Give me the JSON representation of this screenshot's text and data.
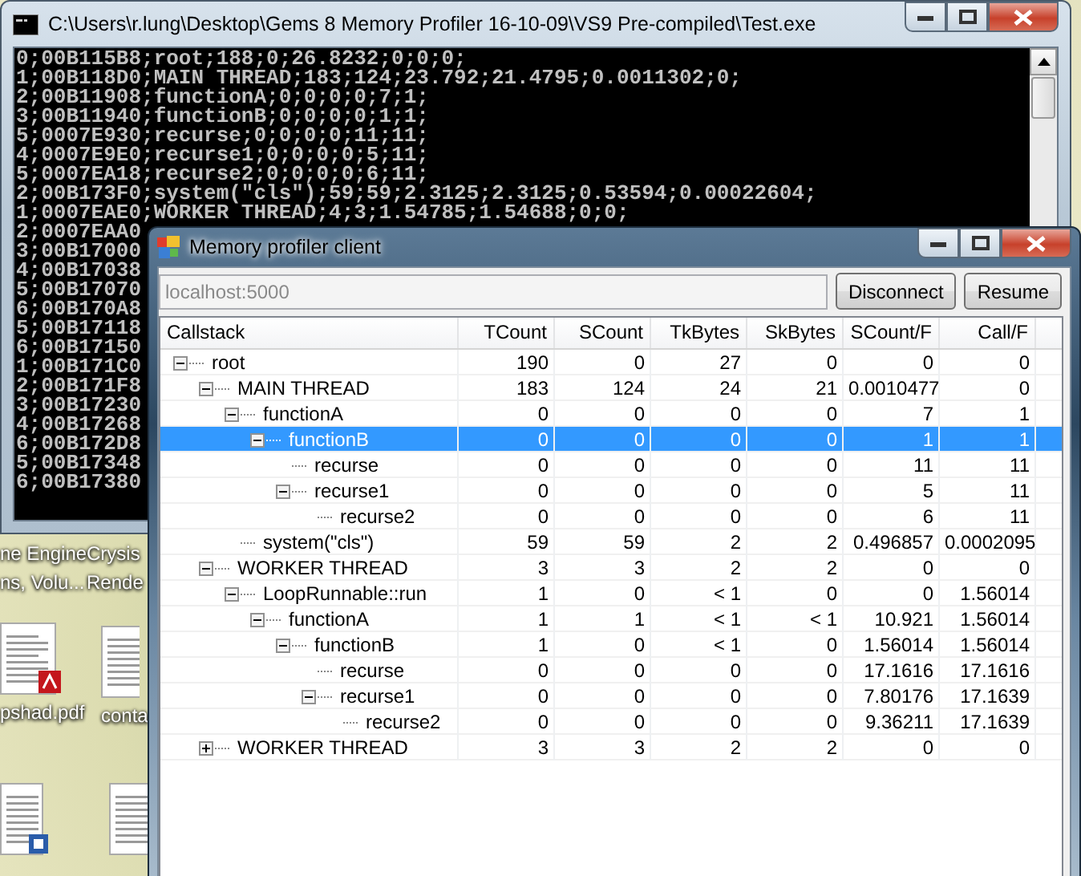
{
  "console": {
    "title": "C:\\Users\\r.lung\\Desktop\\Gems 8 Memory Profiler 16-10-09\\VS9 Pre-compiled\\Test.exe",
    "lines": [
      "0;00B115B8;root;188;0;26.8232;0;0;0;",
      "1;00B118D0;MAIN THREAD;183;124;23.792;21.4795;0.0011302;0;",
      "2;00B11908;functionA;0;0;0;0;7;1;",
      "3;00B11940;functionB;0;0;0;0;1;1;",
      "5;0007E930;recurse;0;0;0;0;11;11;",
      "4;0007E9E0;recurse1;0;0;0;0;5;11;",
      "5;0007EA18;recurse2;0;0;0;0;6;11;",
      "2;00B173F0;system(\"cls\");59;59;2.3125;2.3125;0.53594;0.00022604;",
      "1;0007EAE0;WORKER THREAD;4;3;1.54785;1.54688;0;0;",
      "2;0007EAA0",
      "3;00B17000",
      "4;00B17038",
      "5;00B17070",
      "6;00B170A8",
      "5;00B17118",
      "6;00B17150",
      "1;00B171C0",
      "2;00B171F8",
      "3;00B17230",
      "4;00B17268",
      "6;00B172D8",
      "5;00B17348",
      "6;00B17380"
    ]
  },
  "desktop": {
    "icons": [
      {
        "kind": "plain",
        "labels": [
          "ne Engine",
          "ns, Volu..."
        ]
      },
      {
        "kind": "plain",
        "labels": [
          "Crysis",
          "Rende"
        ]
      },
      {
        "kind": "pdf",
        "labels": [
          "pshad.pdf"
        ]
      },
      {
        "kind": "document",
        "labels": [
          "conta"
        ]
      },
      {
        "kind": "word"
      },
      {
        "kind": "document"
      }
    ]
  },
  "profiler": {
    "title": "Memory profiler client",
    "address": {
      "value": "localhost:5000",
      "disabled": true
    },
    "buttons": [
      "Disconnect",
      "Resume"
    ],
    "tree": {
      "columns": [
        "Callstack",
        "TCount",
        "SCount",
        "TkBytes",
        "SkBytes",
        "SCount/F",
        "Call/F"
      ],
      "nodes": [
        {
          "name": "root",
          "cells": [
            "190",
            "0",
            "27",
            "0",
            "0",
            "0"
          ],
          "selected": false,
          "expanded": true,
          "children": [
            {
              "name": "MAIN THREAD",
              "cells": [
                "183",
                "124",
                "24",
                "21",
                "0.0010477",
                "0"
              ],
              "selected": false,
              "expanded": true,
              "children": [
                {
                  "name": "functionA",
                  "cells": [
                    "0",
                    "0",
                    "0",
                    "0",
                    "7",
                    "1"
                  ],
                  "selected": false,
                  "expanded": true,
                  "children": [
                    {
                      "name": "functionB",
                      "cells": [
                        "0",
                        "0",
                        "0",
                        "0",
                        "1",
                        "1"
                      ],
                      "selected": true,
                      "expanded": true,
                      "children": [
                        {
                          "name": "recurse",
                          "cells": [
                            "0",
                            "0",
                            "0",
                            "0",
                            "11",
                            "11"
                          ],
                          "selected": false
                        },
                        {
                          "name": "recurse1",
                          "cells": [
                            "0",
                            "0",
                            "0",
                            "0",
                            "5",
                            "11"
                          ],
                          "selected": false,
                          "expanded": true,
                          "children": [
                            {
                              "name": "recurse2",
                              "cells": [
                                "0",
                                "0",
                                "0",
                                "0",
                                "6",
                                "11"
                              ],
                              "selected": false
                            }
                          ]
                        }
                      ]
                    }
                  ]
                },
                {
                  "name": "system(\"cls\")",
                  "cells": [
                    "59",
                    "59",
                    "2",
                    "2",
                    "0.496857",
                    "0.0002095"
                  ],
                  "selected": false
                }
              ]
            },
            {
              "name": "WORKER THREAD",
              "cells": [
                "3",
                "3",
                "2",
                "2",
                "0",
                "0"
              ],
              "selected": false,
              "expanded": true,
              "children": [
                {
                  "name": "LoopRunnable::run",
                  "cells": [
                    "1",
                    "0",
                    "< 1",
                    "0",
                    "0",
                    "1.56014"
                  ],
                  "selected": false,
                  "expanded": true,
                  "children": [
                    {
                      "name": "functionA",
                      "cells": [
                        "1",
                        "1",
                        "< 1",
                        "< 1",
                        "10.921",
                        "1.56014"
                      ],
                      "selected": false,
                      "expanded": true,
                      "children": [
                        {
                          "name": "functionB",
                          "cells": [
                            "1",
                            "0",
                            "< 1",
                            "0",
                            "1.56014",
                            "1.56014"
                          ],
                          "selected": false,
                          "expanded": true,
                          "children": [
                            {
                              "name": "recurse",
                              "cells": [
                                "0",
                                "0",
                                "0",
                                "0",
                                "17.1616",
                                "17.1616"
                              ],
                              "selected": false
                            },
                            {
                              "name": "recurse1",
                              "cells": [
                                "0",
                                "0",
                                "0",
                                "0",
                                "7.80176",
                                "17.1639"
                              ],
                              "selected": false,
                              "expanded": true,
                              "children": [
                                {
                                  "name": "recurse2",
                                  "cells": [
                                    "0",
                                    "0",
                                    "0",
                                    "0",
                                    "9.36211",
                                    "17.1639"
                                  ],
                                  "selected": false
                                }
                              ]
                            }
                          ]
                        }
                      ]
                    }
                  ]
                }
              ]
            },
            {
              "name": "WORKER THREAD",
              "cells": [
                "3",
                "3",
                "2",
                "2",
                "0",
                "0"
              ],
              "selected": false,
              "expanded": false
            }
          ]
        }
      ]
    }
  }
}
